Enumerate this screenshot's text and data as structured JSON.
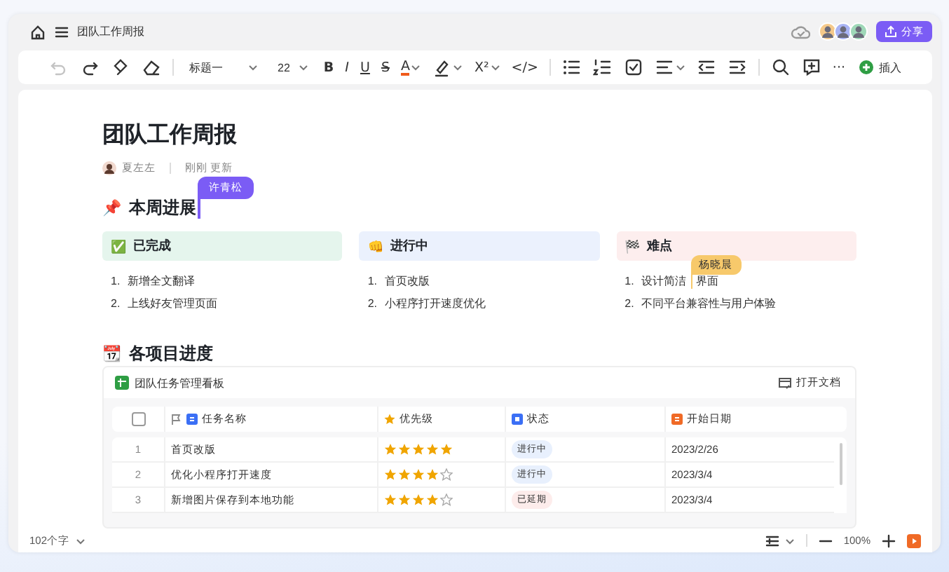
{
  "header": {
    "title": "团队工作周报",
    "share": "分享",
    "avatars": [
      {
        "color": "#f5c98a"
      },
      {
        "color": "#a9b4f5"
      },
      {
        "color": "#9fd8b8"
      }
    ]
  },
  "toolbar": [
    {
      "kind": "undo",
      "disabled": true
    },
    {
      "kind": "redo",
      "disabled": false
    },
    {
      "kind": "brush",
      "disabled": false
    },
    {
      "kind": "eraser",
      "disabled": false
    },
    {
      "kind": "sep"
    },
    {
      "kind": "style",
      "label": "标题一"
    },
    {
      "kind": "size",
      "label": "22"
    },
    {
      "kind": "bold",
      "label": "B"
    },
    {
      "kind": "italic",
      "label": "I"
    },
    {
      "kind": "underline",
      "label": "U"
    },
    {
      "kind": "strike",
      "label": "S"
    },
    {
      "kind": "fontcolor",
      "label": "A",
      "caret": true
    },
    {
      "kind": "highlight",
      "caret": true,
      "disabled": false
    },
    {
      "kind": "plain",
      "label": "X²",
      "caret": true
    },
    {
      "kind": "plain",
      "label": "</>"
    },
    {
      "kind": "sep"
    },
    {
      "kind": "bullets",
      "disabled": false
    },
    {
      "kind": "numbers",
      "disabled": false
    },
    {
      "kind": "checkbox",
      "disabled": false
    },
    {
      "kind": "align",
      "caret": true,
      "disabled": false
    },
    {
      "kind": "outdent",
      "disabled": false
    },
    {
      "kind": "indent",
      "disabled": false
    },
    {
      "kind": "sep"
    },
    {
      "kind": "search",
      "disabled": false
    },
    {
      "kind": "comment",
      "disabled": false
    },
    {
      "kind": "plain",
      "label": "···"
    },
    {
      "kind": "insert",
      "label": "插入"
    }
  ],
  "doc": {
    "title": "团队工作周报",
    "author": "夏左左",
    "updated": "刚刚 更新",
    "section1": {
      "emoji": "📌",
      "heading": "本周进展",
      "cursor": {
        "name": "许青松",
        "color": "#7b5cf5"
      }
    },
    "cards": [
      {
        "emoji": "✅",
        "title": "已完成",
        "color": "#e5f5ed",
        "items": [
          {
            "number": "1.",
            "text": "新增全文翻译"
          },
          {
            "number": "2.",
            "text": "上线好友管理页面"
          }
        ]
      },
      {
        "emoji": "👊",
        "title": "进行中",
        "color": "#ebf1fd",
        "items": [
          {
            "number": "1.",
            "text": "首页改版"
          },
          {
            "number": "2.",
            "text": "小程序打开速度优化"
          }
        ]
      },
      {
        "emoji": "🏁",
        "title": "难点",
        "color": "#fdeeee",
        "items": [
          {
            "number": "1.",
            "text": "设计简洁",
            "cursor": {
              "name": "杨晓晨",
              "color": "#f7c96b"
            },
            "text_after": "界面"
          },
          {
            "number": "2.",
            "text": "不同平台兼容性与用户体验"
          }
        ]
      }
    ],
    "section2": {
      "emoji": "📆",
      "heading": "各项目进度"
    },
    "table": {
      "title": "团队任务管理看板",
      "open": "打开文档",
      "select_all": {
        "checked": false
      },
      "columns": [
        {
          "label": "任务名称",
          "kind": "text"
        },
        {
          "label": "优先级",
          "kind": "rating"
        },
        {
          "label": "状态",
          "kind": "status"
        },
        {
          "label": "开始日期",
          "kind": "date"
        }
      ],
      "rows": [
        {
          "index": "1",
          "name": "首页改版",
          "stars": 5,
          "status": "进行中",
          "color": "#e8f0fd",
          "date": "2023/2/26"
        },
        {
          "index": "2",
          "name": "优化小程序打开速度",
          "stars": 4,
          "status": "进行中",
          "color": "#e8f0fd",
          "date": "2023/3/4"
        },
        {
          "index": "3",
          "name": "新增图片保存到本地功能",
          "stars": 4,
          "status": "已延期",
          "color": "#fdeceb",
          "date": "2023/3/4"
        }
      ]
    }
  },
  "status_bar": {
    "words": "102个字",
    "zoom": "100%"
  }
}
